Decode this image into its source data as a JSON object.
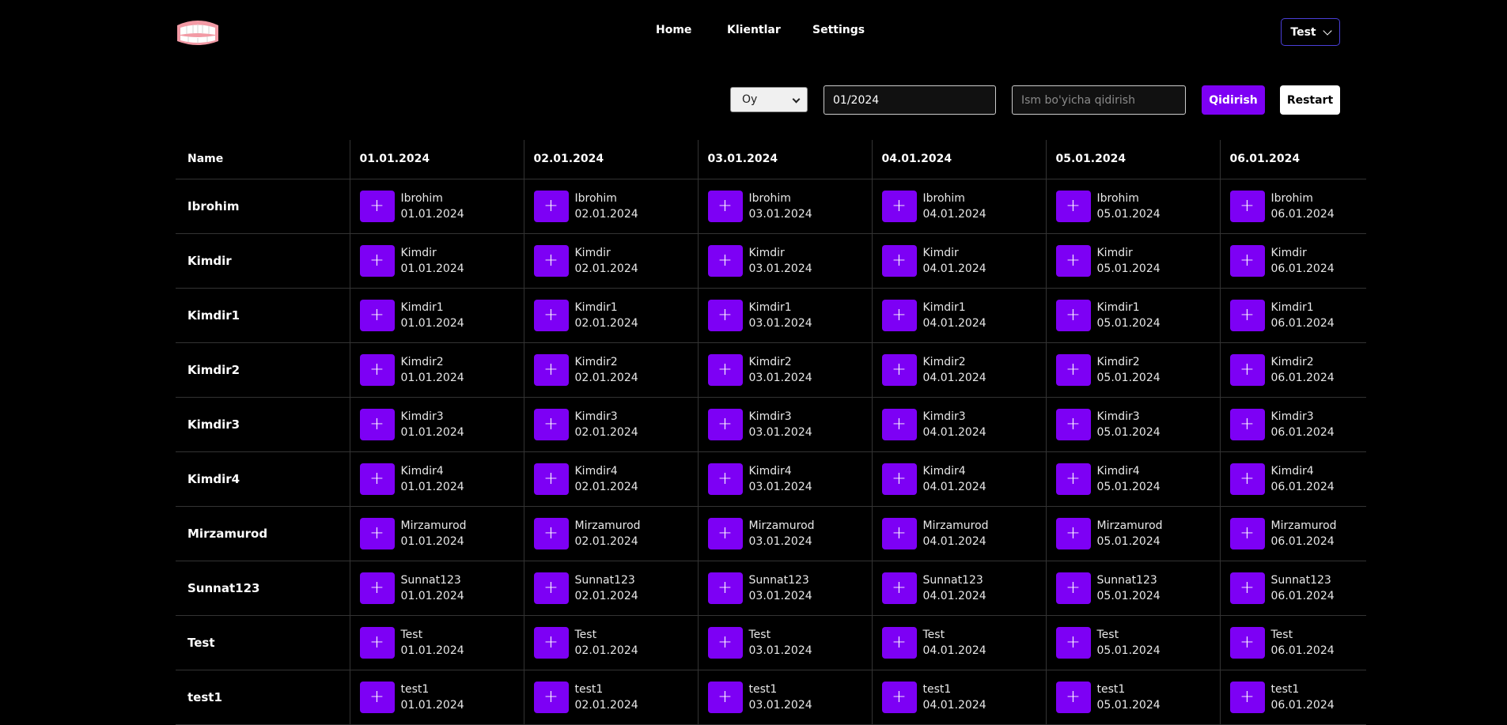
{
  "nav": {
    "links": [
      "Home",
      "Klientlar",
      "Settings"
    ],
    "user_label": "Test"
  },
  "filters": {
    "period_select": "Oy",
    "date_value": "01/2024",
    "search_placeholder": "Ism bo'yicha qidirish",
    "search_button": "Qidirish",
    "restart_button": "Restart"
  },
  "table": {
    "name_header": "Name",
    "dates": [
      "01.01.2024",
      "02.01.2024",
      "03.01.2024",
      "04.01.2024",
      "05.01.2024",
      "06.01.2024"
    ],
    "rows": [
      "Ibrohim",
      "Kimdir",
      "Kimdir1",
      "Kimdir2",
      "Kimdir3",
      "Kimdir4",
      "Mirzamurod",
      "Sunnat123",
      "Test",
      "test1"
    ],
    "add_symbol": "+"
  },
  "colors": {
    "accent": "#7d00f5",
    "background": "#000000"
  },
  "icons": {
    "logo": "teeth-logo-icon",
    "dropdown": "chevron-down-icon",
    "add": "plus-icon"
  }
}
